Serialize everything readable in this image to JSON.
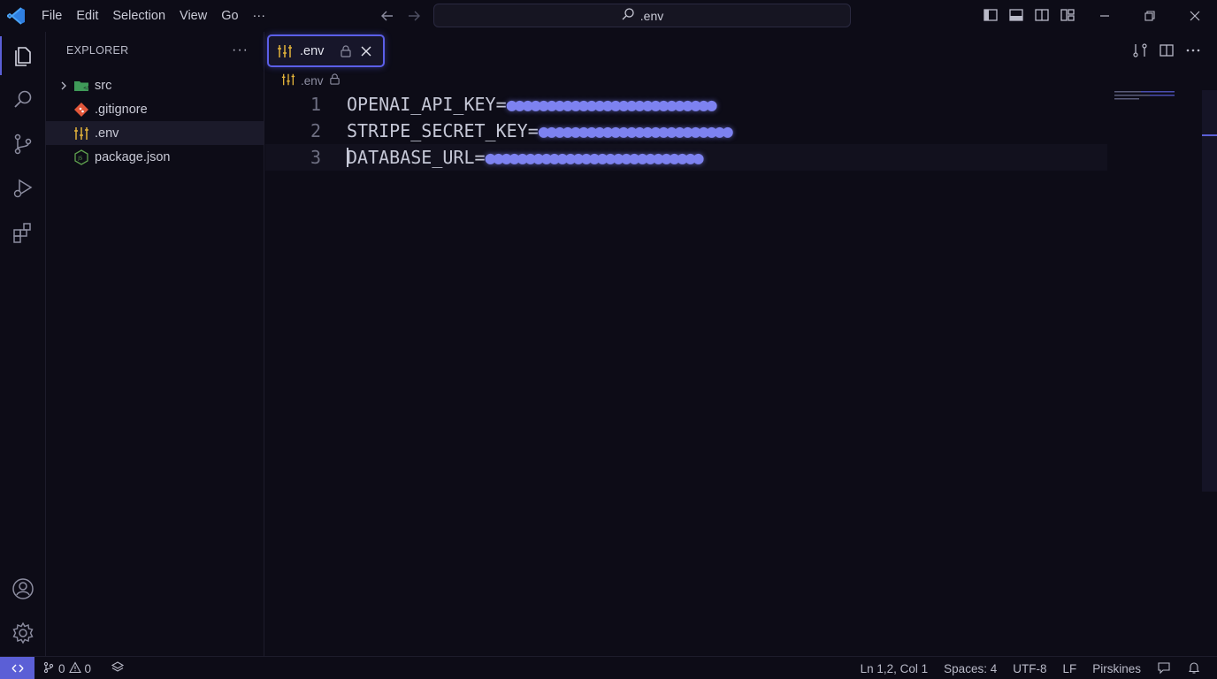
{
  "titlebar": {
    "menu": [
      "File",
      "Edit",
      "Selection",
      "View",
      "Go",
      "···"
    ],
    "search_text": ".env"
  },
  "activity": [
    "explorer-icon",
    "search-icon",
    "source-control-icon",
    "run-debug-icon",
    "extensions-icon",
    "account-icon",
    "settings-gear-icon"
  ],
  "sidebar": {
    "title": "EXPLORER",
    "more": "···",
    "items": [
      {
        "label": "src",
        "type": "folder"
      },
      {
        "label": ".gitignore",
        "type": "file"
      },
      {
        "label": ".env",
        "type": "file",
        "selected": true
      },
      {
        "label": "package.json",
        "type": "file"
      }
    ]
  },
  "editor": {
    "tab_label": ".env",
    "breadcrumb": ".env",
    "lines": [
      {
        "no": "1",
        "key": "OPENAI_API_KEY=",
        "masked": "●●●●●●●●●●●●●●●●●●●●●●●●●●"
      },
      {
        "no": "2",
        "key": "STRIPE_SECRET_KEY=",
        "masked": "●●●●●●●●●●●●●●●●●●●●●●●●"
      },
      {
        "no": "3",
        "key": "DATABASE_URL=",
        "masked": "●●●●●●●●●●●●●●●●●●●●●●●●●●●"
      }
    ]
  },
  "statusbar": {
    "errors": "0",
    "warnings": "0",
    "position": "Ln 1,2, Col 1",
    "spaces": "Spaces: 4",
    "encoding": "UTF-8",
    "eol": "LF",
    "language": "Pirskines"
  },
  "colors": {
    "accent": "#5b5fd6",
    "masked_text": "#7d82f0",
    "background": "#0d0c17"
  }
}
